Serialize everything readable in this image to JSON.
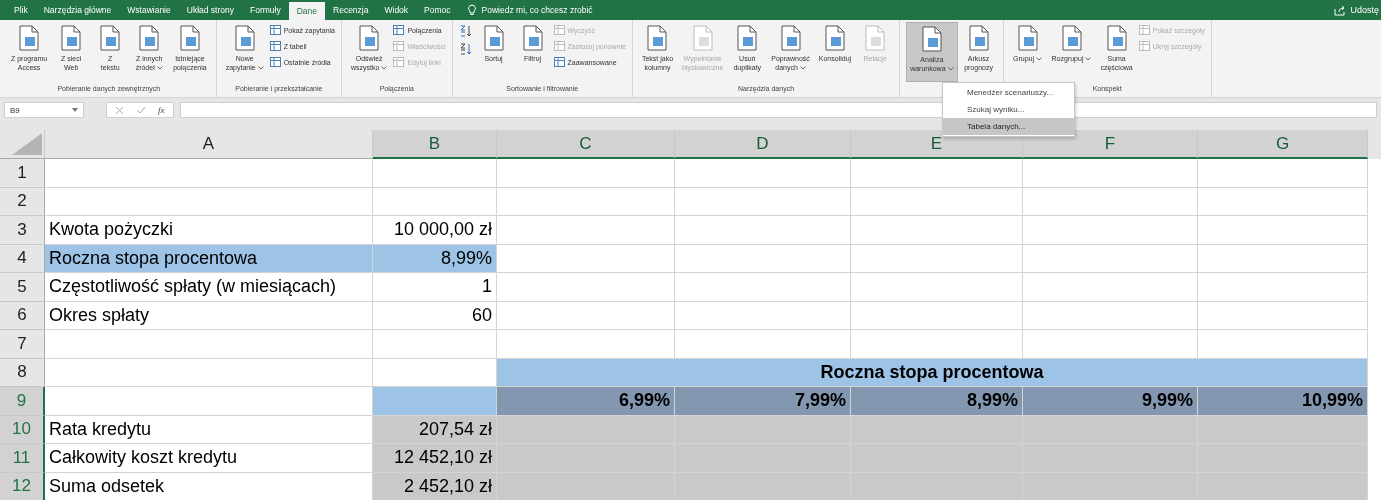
{
  "tabs": [
    {
      "label": "Plik",
      "selected": false
    },
    {
      "label": "Narzędzia główne",
      "selected": false
    },
    {
      "label": "Wstawianie",
      "selected": false
    },
    {
      "label": "Układ strony",
      "selected": false
    },
    {
      "label": "Formuły",
      "selected": false
    },
    {
      "label": "Dane",
      "selected": true
    },
    {
      "label": "Recenzja",
      "selected": false
    },
    {
      "label": "Widok",
      "selected": false
    },
    {
      "label": "Pomoc",
      "selected": false
    }
  ],
  "tell_me": {
    "placeholder": "Powiedz mi, co chcesz zrobić"
  },
  "share": {
    "label": "Udostę"
  },
  "ribbon": [
    {
      "label": "Pobieranie danych zewnętrznych",
      "items": [
        {
          "kind": "large",
          "lines": [
            "Z programu",
            "Access"
          ],
          "disabled": false,
          "pressed": false,
          "caret": false
        },
        {
          "kind": "large",
          "lines": [
            "Z sieci",
            "Web"
          ],
          "disabled": false,
          "pressed": false,
          "caret": false
        },
        {
          "kind": "large",
          "lines": [
            "Z",
            "tekstu"
          ],
          "disabled": false,
          "pressed": false,
          "caret": false
        },
        {
          "kind": "large",
          "lines": [
            "Z innych",
            "źródeł"
          ],
          "disabled": false,
          "pressed": false,
          "caret": true
        },
        {
          "kind": "large",
          "lines": [
            "Istniejące",
            "połączenia"
          ],
          "disabled": false,
          "pressed": false,
          "caret": false
        }
      ]
    },
    {
      "label": "Pobieranie i przekształcanie",
      "items": [
        {
          "kind": "large",
          "lines": [
            "Nowe",
            "zapytanie"
          ],
          "disabled": false,
          "pressed": false,
          "caret": true
        },
        {
          "kind": "smalls",
          "entries": [
            {
              "label": "Pokaż zapytania",
              "disabled": false
            },
            {
              "label": "Z tabeli",
              "disabled": false
            },
            {
              "label": "Ostatnie źródła",
              "disabled": false
            }
          ]
        }
      ]
    },
    {
      "label": "Połączenia",
      "items": [
        {
          "kind": "large",
          "lines": [
            "Odśwież",
            "wszystko"
          ],
          "disabled": false,
          "pressed": false,
          "caret": true
        },
        {
          "kind": "smalls",
          "entries": [
            {
              "label": "Połączenia",
              "disabled": false
            },
            {
              "label": "Właściwości",
              "disabled": true
            },
            {
              "label": "Edytuj linki",
              "disabled": true
            }
          ]
        }
      ]
    },
    {
      "label": "Sortowanie i filtrowanie",
      "items": [
        {
          "kind": "sort-pair"
        },
        {
          "kind": "large",
          "lines": [
            "Sortuj"
          ],
          "disabled": false,
          "pressed": false,
          "caret": false
        },
        {
          "kind": "large",
          "lines": [
            "Filtruj"
          ],
          "disabled": false,
          "pressed": false,
          "caret": false
        },
        {
          "kind": "smalls",
          "entries": [
            {
              "label": "Wyczyść",
              "disabled": true
            },
            {
              "label": "Zastosuj ponownie",
              "disabled": true
            },
            {
              "label": "Zaawansowane",
              "disabled": false
            }
          ]
        }
      ]
    },
    {
      "label": "Narzędzia danych",
      "items": [
        {
          "kind": "large",
          "lines": [
            "Tekst jako",
            "kolumny"
          ],
          "disabled": false,
          "pressed": false,
          "caret": false
        },
        {
          "kind": "large",
          "lines": [
            "Wypełnianie",
            "błyskawiczne"
          ],
          "disabled": true,
          "pressed": false,
          "caret": false
        },
        {
          "kind": "large",
          "lines": [
            "Usuń",
            "duplikaty"
          ],
          "disabled": false,
          "pressed": false,
          "caret": false
        },
        {
          "kind": "large",
          "lines": [
            "Poprawność",
            "danych"
          ],
          "disabled": false,
          "pressed": false,
          "caret": true
        },
        {
          "kind": "large",
          "lines": [
            "Konsoliduj"
          ],
          "disabled": false,
          "pressed": false,
          "caret": false
        },
        {
          "kind": "large",
          "lines": [
            "Relacje"
          ],
          "disabled": true,
          "pressed": false,
          "caret": false
        }
      ]
    },
    {
      "items": [
        {
          "kind": "large",
          "lines": [
            "Analiza",
            "warunkowa"
          ],
          "disabled": false,
          "pressed": true,
          "caret": true
        },
        {
          "kind": "large",
          "lines": [
            "Arkusz",
            "prognozy"
          ],
          "disabled": false,
          "pressed": false,
          "caret": false
        }
      ]
    },
    {
      "label": "Konspekt",
      "items": [
        {
          "kind": "large",
          "lines": [
            "Grupuj"
          ],
          "disabled": false,
          "pressed": false,
          "caret": true
        },
        {
          "kind": "large",
          "lines": [
            "Rozgrupuj"
          ],
          "disabled": false,
          "pressed": false,
          "caret": true
        },
        {
          "kind": "large",
          "lines": [
            "Suma",
            "częściowa"
          ],
          "disabled": false,
          "pressed": false,
          "caret": false
        },
        {
          "kind": "smalls",
          "entries": [
            {
              "label": "Pokaż szczegóły",
              "disabled": true
            },
            {
              "label": "Ukryj szczegóły",
              "disabled": true
            }
          ]
        }
      ]
    }
  ],
  "menu": [
    {
      "label": "Menedżer scenariuszy...",
      "selected": false
    },
    {
      "label": "Szukaj wyniku...",
      "selected": false
    },
    {
      "label": "Tabela danych...",
      "selected": true
    }
  ],
  "formula_bar": {
    "name_box": "B9",
    "function_label": "fx"
  },
  "columns": [
    {
      "label": "A",
      "selected": false
    },
    {
      "label": "B",
      "selected": true
    },
    {
      "label": "C",
      "selected": true
    },
    {
      "label": "D",
      "selected": true
    },
    {
      "label": "E",
      "selected": true
    },
    {
      "label": "F",
      "selected": true
    },
    {
      "label": "G",
      "selected": true
    }
  ],
  "rows": [
    {
      "number": "1",
      "selected": false,
      "cells": [
        {},
        {},
        {},
        {},
        {},
        {},
        {}
      ]
    },
    {
      "number": "2",
      "selected": false,
      "cells": [
        {},
        {},
        {},
        {},
        {},
        {},
        {}
      ]
    },
    {
      "number": "3",
      "selected": false,
      "cells": [
        {
          "text": "Kwota pożyczki"
        },
        {
          "text": "10 000,00 zł",
          "kind": "number"
        },
        {},
        {},
        {},
        {},
        {}
      ]
    },
    {
      "number": "4",
      "selected": false,
      "cells": [
        {
          "text": "Roczna stopa procentowa",
          "color": "#9dc3e6"
        },
        {
          "text": "8,99%",
          "kind": "number",
          "color": "#9dc3e6"
        },
        {},
        {},
        {},
        {},
        {}
      ]
    },
    {
      "number": "5",
      "selected": false,
      "cells": [
        {
          "text": "Częstotliwość spłaty (w miesiącach)"
        },
        {
          "text": "1",
          "kind": "number"
        },
        {},
        {},
        {},
        {},
        {}
      ]
    },
    {
      "number": "6",
      "selected": false,
      "cells": [
        {
          "text": "Okres spłaty"
        },
        {
          "text": "60",
          "kind": "number"
        },
        {},
        {},
        {},
        {},
        {}
      ]
    },
    {
      "number": "7",
      "selected": false,
      "cells": [
        {},
        {},
        {},
        {},
        {},
        {},
        {}
      ]
    },
    {
      "number": "8",
      "selected": false,
      "cells": [
        {},
        {},
        {
          "text": "Roczna stopa procentowa",
          "kind": "heading",
          "color": "#9dc3e6"
        }
      ]
    },
    {
      "number": "9",
      "selected": true,
      "cells": [
        {},
        {
          "color": "#9dc3e6"
        },
        {
          "text": "6,99%",
          "kind": "heading-number",
          "color": "#8497b0"
        },
        {
          "text": "7,99%",
          "kind": "heading-number",
          "color": "#8497b0"
        },
        {
          "text": "8,99%",
          "kind": "heading-number",
          "color": "#8497b0"
        },
        {
          "text": "9,99%",
          "kind": "heading-number",
          "color": "#8497b0"
        },
        {
          "text": "10,99%",
          "kind": "heading-number",
          "color": "#8497b0"
        }
      ]
    },
    {
      "number": "10",
      "selected": true,
      "cells": [
        {
          "text": "Rata kredytu"
        },
        {
          "text": "207,54 zł",
          "kind": "number",
          "color": "#c9c9c9"
        },
        {
          "color": "#c9c9c9"
        },
        {
          "color": "#c9c9c9"
        },
        {
          "color": "#c9c9c9"
        },
        {
          "color": "#c9c9c9"
        },
        {
          "color": "#c9c9c9"
        }
      ]
    },
    {
      "number": "11",
      "selected": true,
      "cells": [
        {
          "text": "Całkowity koszt kredytu"
        },
        {
          "text": "12 452,10 zł",
          "kind": "number",
          "color": "#c9c9c9"
        },
        {
          "color": "#c9c9c9"
        },
        {
          "color": "#c9c9c9"
        },
        {
          "color": "#c9c9c9"
        },
        {
          "color": "#c9c9c9"
        },
        {
          "color": "#c9c9c9"
        }
      ]
    },
    {
      "number": "12",
      "selected": true,
      "cells": [
        {
          "text": "Suma odsetek"
        },
        {
          "text": "2 452,10 zł",
          "kind": "number",
          "color": "#c9c9c9"
        },
        {
          "color": "#c9c9c9"
        },
        {
          "color": "#c9c9c9"
        },
        {
          "color": "#c9c9c9"
        },
        {
          "color": "#c9c9c9"
        },
        {
          "color": "#c9c9c9"
        }
      ]
    }
  ]
}
